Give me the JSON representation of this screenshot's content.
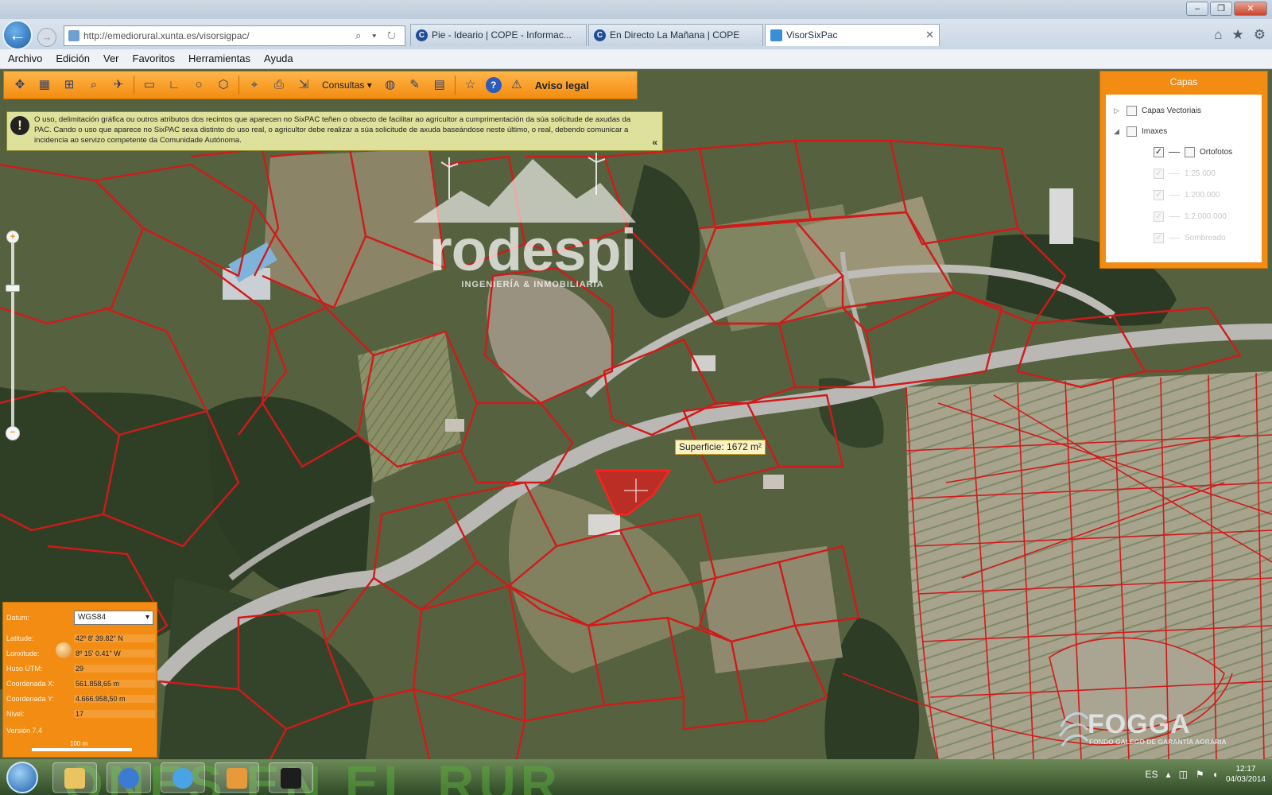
{
  "browser": {
    "window_controls": [
      "–",
      "❐",
      "✕"
    ],
    "address_url": "http://emediorural.xunta.es/visorsigpac/",
    "address_tools": "⌕ ▾ ↻",
    "tabs": [
      {
        "icon": "C",
        "label": "Pie - Ideario | COPE - Informac..."
      },
      {
        "icon": "C",
        "label": "En Directo La Mañana | COPE"
      },
      {
        "icon": "",
        "label": "VisorSixPac",
        "close": "✕"
      }
    ],
    "right_icons": [
      "⌂",
      "★",
      "⚙"
    ]
  },
  "menu": [
    "Archivo",
    "Edición",
    "Ver",
    "Favoritos",
    "Herramientas",
    "Ayuda"
  ],
  "toolbar": {
    "consultas_label": "Consultas ▾",
    "info_label": "?",
    "aviso_label": "Aviso legal"
  },
  "warning": {
    "icon": "!",
    "text": "O uso, delimitación gráfica ou outros atributos dos recintos que aparecen no SixPAC teñen o obxecto de facilitar ao agricultor a cumprimentación da súa solicitude de axudas da PAC. Cando o uso que aparece no SixPAC sexa distinto do uso real, o agricultor debe realizar a súa solicitude de axuda baseándose neste último, o real, debendo comunicar a incidencia ao servizo competente da Comunidade Autónoma.",
    "collapse": "«"
  },
  "watermark": {
    "brand": "rodespi",
    "tagline": "INGENIERÍA & INMOBILIARIA"
  },
  "capas": {
    "title": "Capas",
    "items": [
      {
        "label": "Capas Vectoriais",
        "checked": false,
        "expander": "▷",
        "dim": false
      },
      {
        "label": "Imaxes",
        "checked": false,
        "expander": "◢",
        "dim": false
      },
      {
        "label": "Ortofotos",
        "checked": true,
        "expander": "",
        "dim": false
      },
      {
        "label": "1:25.000",
        "checked": true,
        "expander": "",
        "dim": true
      },
      {
        "label": "1:200.000",
        "checked": true,
        "expander": "",
        "dim": true
      },
      {
        "label": "1:2.000.000",
        "checked": true,
        "expander": "",
        "dim": true
      },
      {
        "label": "Sombreado",
        "checked": true,
        "expander": "",
        "dim": true
      }
    ]
  },
  "zoom": {
    "plus": "+",
    "minus": "−",
    "level": 0.25
  },
  "measure": {
    "label": "Superficie: 1672 m²"
  },
  "coords": {
    "datum_label": "Datum:",
    "datum_value": "WGS84",
    "rows": [
      {
        "label": "Latitude:",
        "value": "42º 8' 39.82\" N"
      },
      {
        "label": "Lonxitude:",
        "value": "8º 15' 0.41\" W"
      },
      {
        "label": "Huso UTM:",
        "value": "29"
      },
      {
        "label": "Coordenada X:",
        "value": "561.858,65 m"
      },
      {
        "label": "Coordenada Y:",
        "value": "4.666.958,50 m"
      },
      {
        "label": "Nivel:",
        "value": "17"
      }
    ],
    "version": "Versión 7.4",
    "scale": "100 m"
  },
  "fogga": {
    "brand": "FOGGA",
    "subtitle": "FONDO GALEGO DE GARANTÍA AGRARIA"
  },
  "taskbar": {
    "watermark": "ONES EN EL RUR",
    "lang": "ES",
    "time": "12:17",
    "date": "04/03/2014"
  },
  "colors": {
    "accent_orange": "#f28c12",
    "parcel_red": "#d11a1a",
    "warning_bg": "#eceea5"
  }
}
